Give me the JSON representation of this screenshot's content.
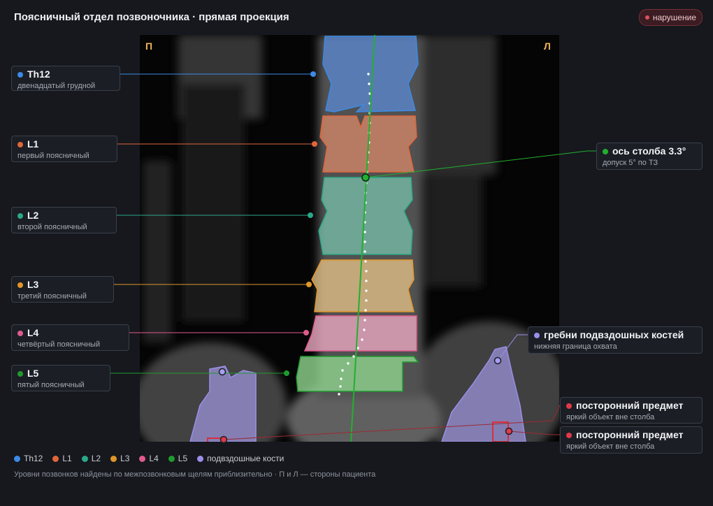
{
  "header": {
    "title": "Поясничный отдел позвоночника · прямая проекция",
    "badge": "нарушение"
  },
  "image": {
    "side_right": "П",
    "side_left": "Л"
  },
  "labels": {
    "th12": {
      "name": "Th12",
      "desc": "двенадцатый грудной",
      "color": "#3b8be6"
    },
    "l1": {
      "name": "L1",
      "desc": "первый поясничный",
      "color": "#e0663a"
    },
    "l2": {
      "name": "L2",
      "desc": "второй поясничный",
      "color": "#2aa88a"
    },
    "l3": {
      "name": "L3",
      "desc": "третий поясничный",
      "color": "#e0962a"
    },
    "l4": {
      "name": "L4",
      "desc": "четвёртый поясничный",
      "color": "#e05a8e"
    },
    "l5": {
      "name": "L5",
      "desc": "пятый поясничный",
      "color": "#1f9a2e"
    },
    "axis": {
      "name": "ось столба 3.3°",
      "desc": "допуск 5° по ТЗ",
      "color": "#22b02e"
    },
    "iliac": {
      "name": "гребни подвздошных костей",
      "desc": "нижняя граница охвата",
      "color": "#9a8fe8"
    },
    "foreign1": {
      "name": "посторонний предмет",
      "desc": "яркий объект вне столба",
      "color": "#e03a48"
    },
    "foreign2": {
      "name": "посторонний предмет",
      "desc": "яркий объект вне столба",
      "color": "#e03a48"
    }
  },
  "legend": [
    {
      "label": "Th12",
      "color": "#3b8be6"
    },
    {
      "label": "L1",
      "color": "#e0663a"
    },
    {
      "label": "L2",
      "color": "#2aa88a"
    },
    {
      "label": "L3",
      "color": "#e0962a"
    },
    {
      "label": "L4",
      "color": "#e05a8e"
    },
    {
      "label": "L5",
      "color": "#1f9a2e"
    },
    {
      "label": "подвздошные кости",
      "color": "#9a8fe8"
    }
  ],
  "footer": "Уровни позвонков найдены по межпозвонковым щелям приблизительно · П и Л — стороны пациента"
}
